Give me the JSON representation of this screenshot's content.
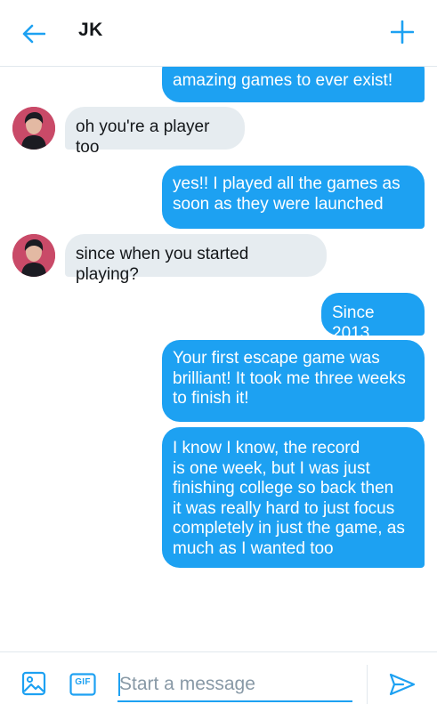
{
  "header": {
    "title": "JK",
    "back_icon": "arrow-left-icon",
    "new_icon": "plus-icon"
  },
  "messages": [
    {
      "direction": "out",
      "text": "amazing games to ever exist!"
    },
    {
      "direction": "in",
      "text": "oh you're a player too"
    },
    {
      "direction": "out",
      "line1": "yes!! I played all the games as",
      "line2": "soon as they were launched"
    },
    {
      "direction": "in",
      "text": "since when you started playing?"
    },
    {
      "direction": "out",
      "text": "Since 2013"
    },
    {
      "direction": "out",
      "line1": "Your first escape game was",
      "line2": "brilliant! It took me three weeks",
      "line3": "to finish it!"
    },
    {
      "direction": "out",
      "line1": "I know I know, the record",
      "line2": "is one week, but I was just",
      "line3": "finishing college so back then",
      "line4": "it was really hard to just focus",
      "line5": "completely in just the game, as",
      "line6": "much as I wanted too"
    }
  ],
  "composer": {
    "placeholder": "Start a message",
    "image_icon": "image-icon",
    "gif_label": "GIF",
    "send_icon": "send-icon"
  },
  "colors": {
    "accent": "#1da1f2",
    "incoming_bubble": "#e6ecf0",
    "avatar_bg": "#c94a68"
  }
}
